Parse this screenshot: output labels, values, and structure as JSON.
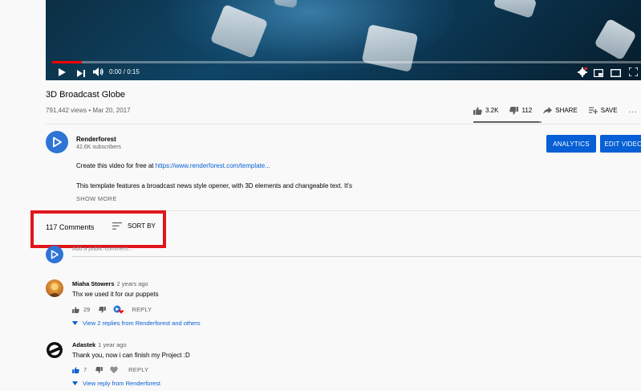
{
  "player": {
    "time_current": "0:00",
    "time_separator": " / ",
    "time_total": "0:15",
    "progress_fraction": 0.05
  },
  "video": {
    "title": "3D Broadcast Globe",
    "views": "791,442 views",
    "date_sep": " • ",
    "date": "Mar 20, 2017",
    "likes": "3.2K",
    "dislikes": "112",
    "share_label": "SHARE",
    "save_label": "SAVE",
    "more": "..."
  },
  "channel": {
    "name": "Renderforest",
    "subscribers": "42.6K subscribers",
    "analytics_label": "ANALYTICS",
    "edit_label": "EDIT VIDEO",
    "desc_line1_prefix": "Create this video for free at ",
    "desc_link": "https://www.renderforest.com/template...",
    "desc_line2": "This template features a broadcast news style opener, with 3D elements and changeable text. It's",
    "show_more": "SHOW MORE"
  },
  "comments_section": {
    "count_label": "117 Comments",
    "sort_label": "SORT BY",
    "add_placeholder": "Add a public comment..."
  },
  "comments": [
    {
      "author": "Miaha Stowers",
      "time": "2 years ago",
      "text": "Thx we used it for our puppets",
      "likes": "29",
      "reply_label": "REPLY",
      "replies_label": "View 2 replies from Renderforest and others"
    },
    {
      "author": "Adastek",
      "time": "1 year ago",
      "text": "Thank you, now i can finish my Project :D",
      "likes": "7",
      "reply_label": "REPLY",
      "replies_label": "View reply from Renderforest"
    }
  ],
  "colors": {
    "highlight_box": "#e0161b",
    "accent_blue": "#065fd4",
    "progress_red": "#ff0000"
  }
}
